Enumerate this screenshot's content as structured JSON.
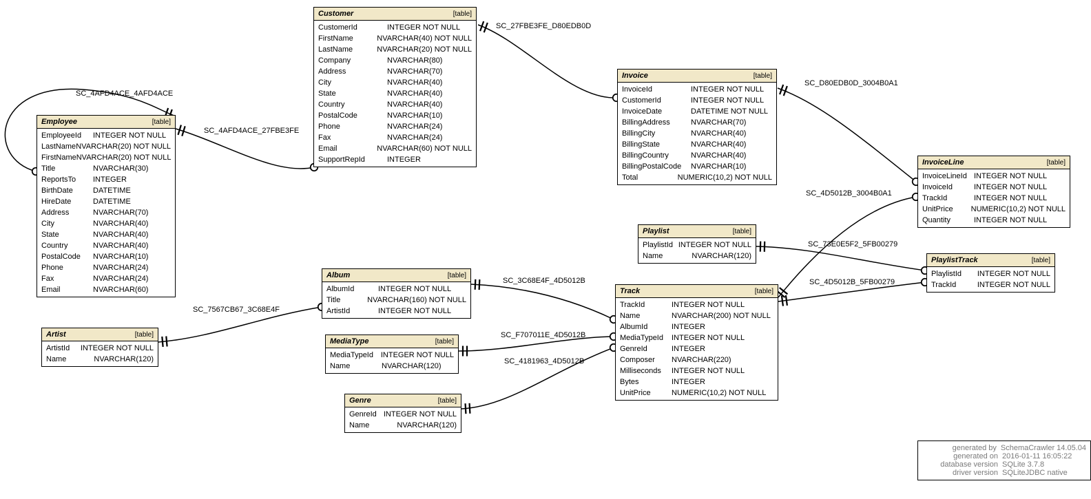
{
  "tables": {
    "employee": {
      "name": "Employee",
      "tag": "[table]",
      "cols": [
        {
          "n": "EmployeeId",
          "t": "INTEGER NOT NULL"
        },
        {
          "n": "LastName",
          "t": "NVARCHAR(20) NOT NULL"
        },
        {
          "n": "FirstName",
          "t": "NVARCHAR(20) NOT NULL"
        },
        {
          "n": "Title",
          "t": "NVARCHAR(30)"
        },
        {
          "n": "ReportsTo",
          "t": "INTEGER"
        },
        {
          "n": "BirthDate",
          "t": "DATETIME"
        },
        {
          "n": "HireDate",
          "t": "DATETIME"
        },
        {
          "n": "Address",
          "t": "NVARCHAR(70)"
        },
        {
          "n": "City",
          "t": "NVARCHAR(40)"
        },
        {
          "n": "State",
          "t": "NVARCHAR(40)"
        },
        {
          "n": "Country",
          "t": "NVARCHAR(40)"
        },
        {
          "n": "PostalCode",
          "t": "NVARCHAR(10)"
        },
        {
          "n": "Phone",
          "t": "NVARCHAR(24)"
        },
        {
          "n": "Fax",
          "t": "NVARCHAR(24)"
        },
        {
          "n": "Email",
          "t": "NVARCHAR(60)"
        }
      ]
    },
    "customer": {
      "name": "Customer",
      "tag": "[table]",
      "cols": [
        {
          "n": "CustomerId",
          "t": "INTEGER NOT NULL"
        },
        {
          "n": "FirstName",
          "t": "NVARCHAR(40) NOT NULL"
        },
        {
          "n": "LastName",
          "t": "NVARCHAR(20) NOT NULL"
        },
        {
          "n": "Company",
          "t": "NVARCHAR(80)"
        },
        {
          "n": "Address",
          "t": "NVARCHAR(70)"
        },
        {
          "n": "City",
          "t": "NVARCHAR(40)"
        },
        {
          "n": "State",
          "t": "NVARCHAR(40)"
        },
        {
          "n": "Country",
          "t": "NVARCHAR(40)"
        },
        {
          "n": "PostalCode",
          "t": "NVARCHAR(10)"
        },
        {
          "n": "Phone",
          "t": "NVARCHAR(24)"
        },
        {
          "n": "Fax",
          "t": "NVARCHAR(24)"
        },
        {
          "n": "Email",
          "t": "NVARCHAR(60) NOT NULL"
        },
        {
          "n": "SupportRepId",
          "t": "INTEGER"
        }
      ]
    },
    "artist": {
      "name": "Artist",
      "tag": "[table]",
      "cols": [
        {
          "n": "ArtistId",
          "t": "INTEGER NOT NULL"
        },
        {
          "n": "Name",
          "t": "NVARCHAR(120)"
        }
      ]
    },
    "album": {
      "name": "Album",
      "tag": "[table]",
      "cols": [
        {
          "n": "AlbumId",
          "t": "INTEGER NOT NULL"
        },
        {
          "n": "Title",
          "t": "NVARCHAR(160) NOT NULL"
        },
        {
          "n": "ArtistId",
          "t": "INTEGER NOT NULL"
        }
      ]
    },
    "mediatype": {
      "name": "MediaType",
      "tag": "[table]",
      "cols": [
        {
          "n": "MediaTypeId",
          "t": "INTEGER NOT NULL"
        },
        {
          "n": "Name",
          "t": "NVARCHAR(120)"
        }
      ]
    },
    "genre": {
      "name": "Genre",
      "tag": "[table]",
      "cols": [
        {
          "n": "GenreId",
          "t": "INTEGER NOT NULL"
        },
        {
          "n": "Name",
          "t": "NVARCHAR(120)"
        }
      ]
    },
    "invoice": {
      "name": "Invoice",
      "tag": "[table]",
      "cols": [
        {
          "n": "InvoiceId",
          "t": "INTEGER NOT NULL"
        },
        {
          "n": "CustomerId",
          "t": "INTEGER NOT NULL"
        },
        {
          "n": "InvoiceDate",
          "t": "DATETIME NOT NULL"
        },
        {
          "n": "BillingAddress",
          "t": "NVARCHAR(70)"
        },
        {
          "n": "BillingCity",
          "t": "NVARCHAR(40)"
        },
        {
          "n": "BillingState",
          "t": "NVARCHAR(40)"
        },
        {
          "n": "BillingCountry",
          "t": "NVARCHAR(40)"
        },
        {
          "n": "BillingPostalCode",
          "t": "NVARCHAR(10)"
        },
        {
          "n": "Total",
          "t": "NUMERIC(10,2) NOT NULL"
        }
      ]
    },
    "playlist": {
      "name": "Playlist",
      "tag": "[table]",
      "cols": [
        {
          "n": "PlaylistId",
          "t": "INTEGER NOT NULL"
        },
        {
          "n": "Name",
          "t": "NVARCHAR(120)"
        }
      ]
    },
    "track": {
      "name": "Track",
      "tag": "[table]",
      "cols": [
        {
          "n": "TrackId",
          "t": "INTEGER NOT NULL"
        },
        {
          "n": "Name",
          "t": "NVARCHAR(200) NOT NULL"
        },
        {
          "n": "AlbumId",
          "t": "INTEGER"
        },
        {
          "n": "MediaTypeId",
          "t": "INTEGER NOT NULL"
        },
        {
          "n": "GenreId",
          "t": "INTEGER"
        },
        {
          "n": "Composer",
          "t": "NVARCHAR(220)"
        },
        {
          "n": "Milliseconds",
          "t": "INTEGER NOT NULL"
        },
        {
          "n": "Bytes",
          "t": "INTEGER"
        },
        {
          "n": "UnitPrice",
          "t": "NUMERIC(10,2) NOT NULL"
        }
      ]
    },
    "invoiceline": {
      "name": "InvoiceLine",
      "tag": "[table]",
      "cols": [
        {
          "n": "InvoiceLineId",
          "t": "INTEGER NOT NULL"
        },
        {
          "n": "InvoiceId",
          "t": "INTEGER NOT NULL"
        },
        {
          "n": "TrackId",
          "t": "INTEGER NOT NULL"
        },
        {
          "n": "UnitPrice",
          "t": "NUMERIC(10,2) NOT NULL"
        },
        {
          "n": "Quantity",
          "t": "INTEGER NOT NULL"
        }
      ]
    },
    "playlisttrack": {
      "name": "PlaylistTrack",
      "tag": "[table]",
      "cols": [
        {
          "n": "PlaylistId",
          "t": "INTEGER NOT NULL"
        },
        {
          "n": "TrackId",
          "t": "INTEGER NOT NULL"
        }
      ]
    }
  },
  "edges": {
    "emp_self": "SC_4AFD4ACE_4AFD4ACE",
    "cust_emp": "SC_4AFD4ACE_27FBE3FE",
    "inv_cust": "SC_27FBE3FE_D80EDB0D",
    "album_artist": "SC_7567CB67_3C68E4F",
    "track_album": "SC_3C68E4F_4D5012B",
    "track_media": "SC_F707011E_4D5012B",
    "track_genre": "SC_4181963_4D5012B",
    "il_invoice": "SC_D80EDB0D_3004B0A1",
    "il_track": "SC_4D5012B_3004B0A1",
    "pt_playlist": "SC_73E0E5F2_5FB00279",
    "pt_track": "SC_4D5012B_5FB00279"
  },
  "meta": {
    "r1k": "generated by",
    "r1v": "SchemaCrawler 14.05.04",
    "r2k": "generated on",
    "r2v": "2016-01-11 16:05:22",
    "r3k": "database version",
    "r3v": "SQLite 3.7.8",
    "r4k": "driver version",
    "r4v": "SQLiteJDBC native"
  }
}
